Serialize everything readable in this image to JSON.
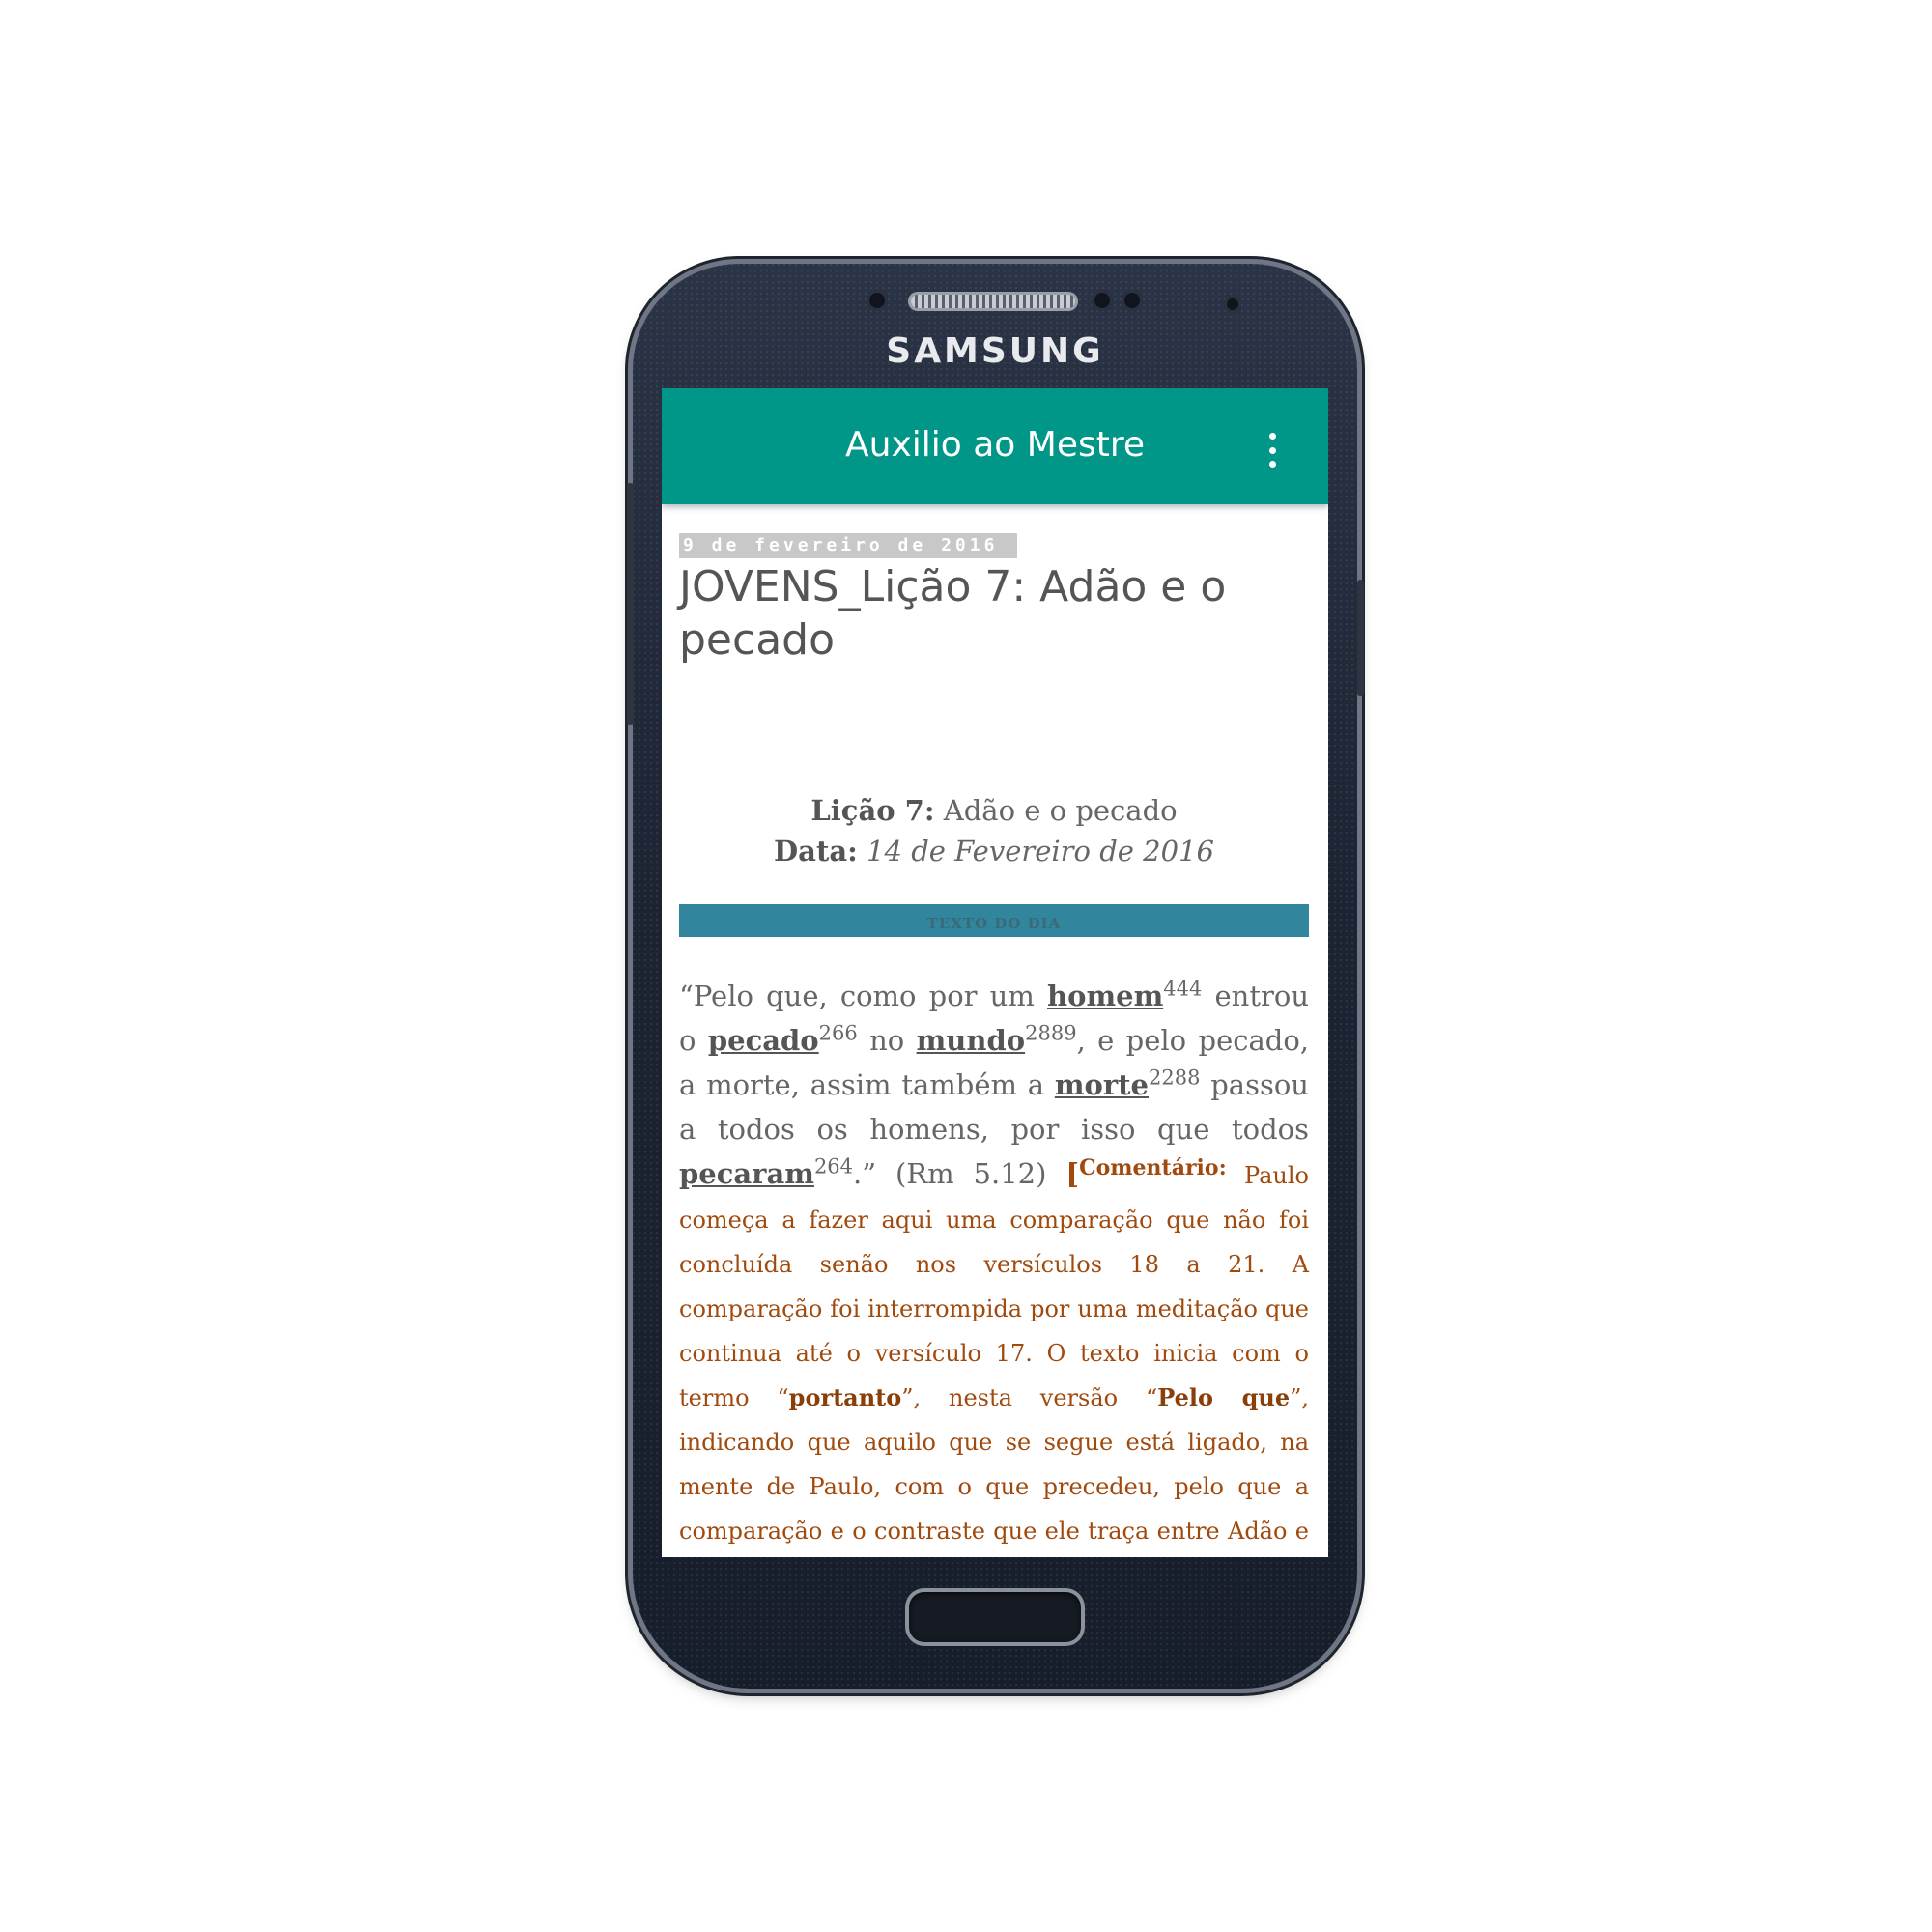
{
  "device": {
    "brand": "SAMSUNG"
  },
  "appbar": {
    "title": "Auxilio ao Mestre",
    "menu_icon": "more-vert-icon"
  },
  "post": {
    "date": "9 de fevereiro de 2016",
    "title": "JOVENS_Lição 7: Adão e o pecado",
    "lesson_label": "Lição 7:",
    "lesson_value": " Adão e o pecado",
    "date_label": "Data:",
    "date_value": " 14 de Fevereiro de 2016",
    "section_header": "TEXTO DO DIA"
  },
  "verse": {
    "t1": "“Pelo que, como por um ",
    "w1": "homem",
    "n1": "444",
    "t2": " entrou o ",
    "w2": "pecado",
    "n2": "266",
    "t3": " no ",
    "w3": "mundo",
    "n3": "2889",
    "t4": ", e pelo pecado, a morte, assim também a ",
    "w4": "morte",
    "n4": "2288",
    "t5": " passou a todos os homens, por isso que todos ",
    "w5": "pecaram",
    "n5": "264",
    "t6": ".” (Rm 5.12) ",
    "comment_bracket": "[",
    "comment_label": "Comentário:",
    "c1": " Paulo começa a fazer aqui uma comparação que não foi concluída senão nos versículos 18 a 21. A comparação foi interrompida por uma meditação que continua até o versículo 17. O texto inicia com o termo “",
    "c_bold1": "portanto",
    "c2": "”, nesta versão “",
    "c_bold2": "Pelo que",
    "c3": "”, indicando que aquilo que se segue está ligado, na mente de Paulo, com o que precedeu, pelo que a comparação e o contraste que ele traça entre Adão e Cristo é sua elaboração teológica do que já havia sido dito. Paulo salienta a idéia de “um só homem” por toda esta passagem, e isso indica que ele encarava tanto Adão como Cristo como indivíduos"
  }
}
